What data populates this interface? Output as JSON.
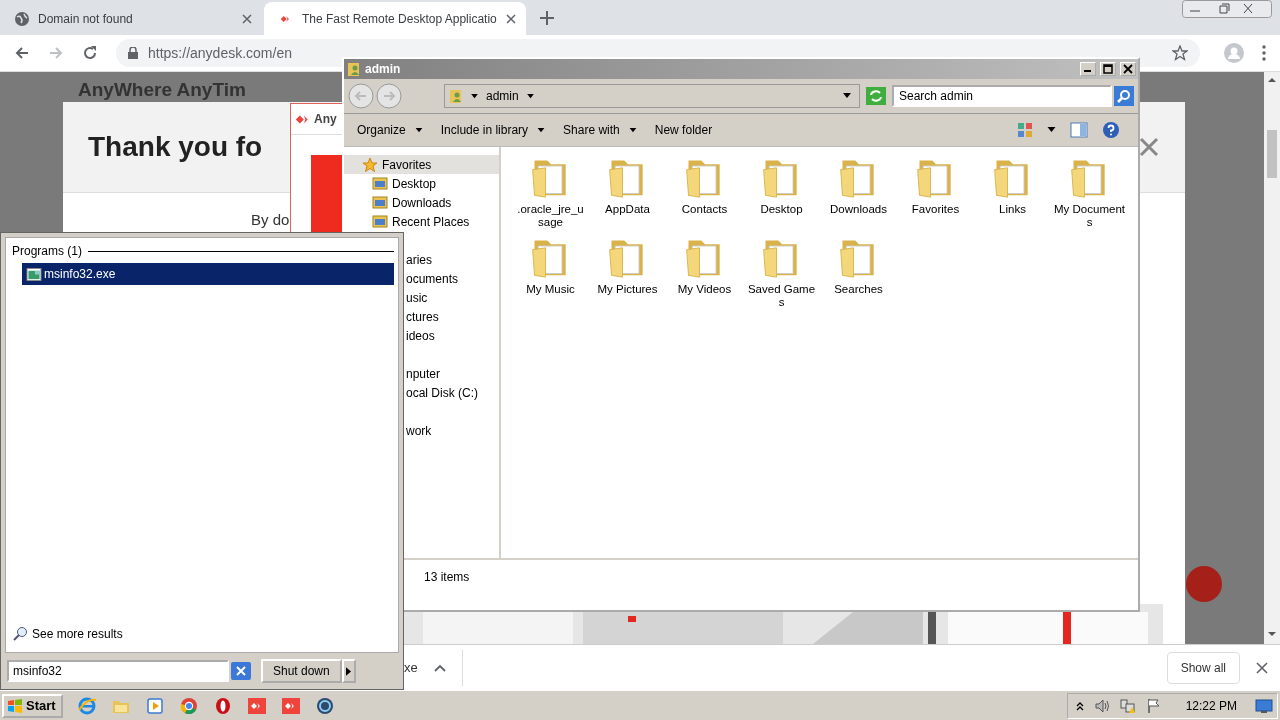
{
  "browser": {
    "tabs": [
      {
        "title": "Domain not found",
        "selected": false,
        "kind": "globe"
      },
      {
        "title": "The Fast Remote Desktop Applicatio",
        "selected": true,
        "kind": "diamond"
      }
    ],
    "url": "https://anydesk.com/en"
  },
  "webpage": {
    "headline": "AnyWhere AnyTim",
    "dialog_title": "Thank you fo",
    "dialog_text": "By do",
    "app_window_title": "Any"
  },
  "download_bar": {
    "file": "xe",
    "show_all": "Show all"
  },
  "explorer": {
    "title": "admin",
    "breadcrumb": "admin",
    "search_placeholder": "Search admin",
    "toolbar": [
      {
        "label": "Organize",
        "has_menu": true
      },
      {
        "label": "Include in library",
        "has_menu": true
      },
      {
        "label": "Share with",
        "has_menu": true
      },
      {
        "label": "New folder",
        "has_menu": false
      }
    ],
    "nav": [
      {
        "label": "Favorites",
        "kind": "group",
        "selected": true
      },
      {
        "label": "Desktop",
        "kind": "item",
        "selected": false
      },
      {
        "label": "Downloads",
        "kind": "item",
        "selected": false
      },
      {
        "label": "Recent Places",
        "kind": "item",
        "selected": false
      },
      {
        "label": "aries",
        "kind": "cut-group",
        "selected": false
      },
      {
        "label": "ocuments",
        "kind": "cut-item",
        "selected": false
      },
      {
        "label": "usic",
        "kind": "cut-item",
        "selected": false
      },
      {
        "label": "ctures",
        "kind": "cut-item",
        "selected": false
      },
      {
        "label": "ideos",
        "kind": "cut-item",
        "selected": false
      },
      {
        "label": "nputer",
        "kind": "cut-group",
        "selected": false
      },
      {
        "label": "ocal Disk (C:)",
        "kind": "cut-item",
        "selected": false
      },
      {
        "label": "work",
        "kind": "cut-group",
        "selected": false
      }
    ],
    "files": [
      {
        "name": ".oracle_jre_usage"
      },
      {
        "name": "AppData"
      },
      {
        "name": "Contacts"
      },
      {
        "name": "Desktop"
      },
      {
        "name": "Downloads"
      },
      {
        "name": "Favorites"
      },
      {
        "name": "Links"
      },
      {
        "name": "My Documents"
      },
      {
        "name": "My Music"
      },
      {
        "name": "My Pictures"
      },
      {
        "name": "My Videos"
      },
      {
        "name": "Saved Games"
      },
      {
        "name": "Searches"
      }
    ],
    "status": "13 items"
  },
  "start_menu": {
    "section": "Programs (1)",
    "results": [
      {
        "name": "msinfo32.exe",
        "selected": true
      }
    ],
    "see_more": "See more results",
    "search_value": "msinfo32",
    "shutdown": "Shut down"
  },
  "taskbar": {
    "start": "Start",
    "clock": "12:22 PM"
  }
}
